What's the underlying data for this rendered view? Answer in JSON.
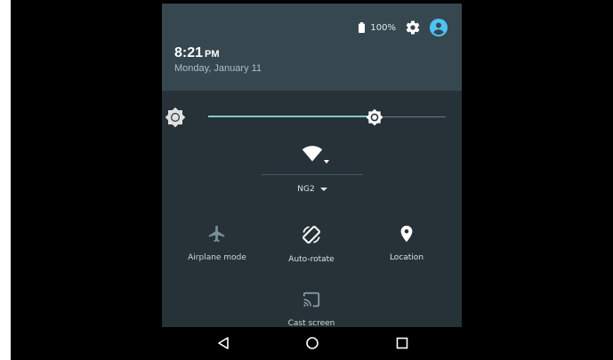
{
  "status": {
    "battery": "100%"
  },
  "header": {
    "time": "8:21",
    "ampm": "PM",
    "date": "Monday, January 11"
  },
  "brightness": {
    "level": 0.7
  },
  "wifi": {
    "network": "NG2"
  },
  "tiles": [
    {
      "label": "Airplane mode",
      "icon": "airplane-icon"
    },
    {
      "label": "Auto-rotate",
      "icon": "auto-rotate-icon"
    },
    {
      "label": "Location",
      "icon": "location-icon"
    },
    {
      "label": "Cast screen",
      "icon": "cast-icon"
    }
  ],
  "navbar": {
    "back": "back-icon",
    "home": "home-icon",
    "recents": "recents-icon"
  },
  "colors": {
    "header": "#37474f",
    "panel": "#263238",
    "accent": "#80cbc4",
    "avatar": "#4fc3f7"
  }
}
